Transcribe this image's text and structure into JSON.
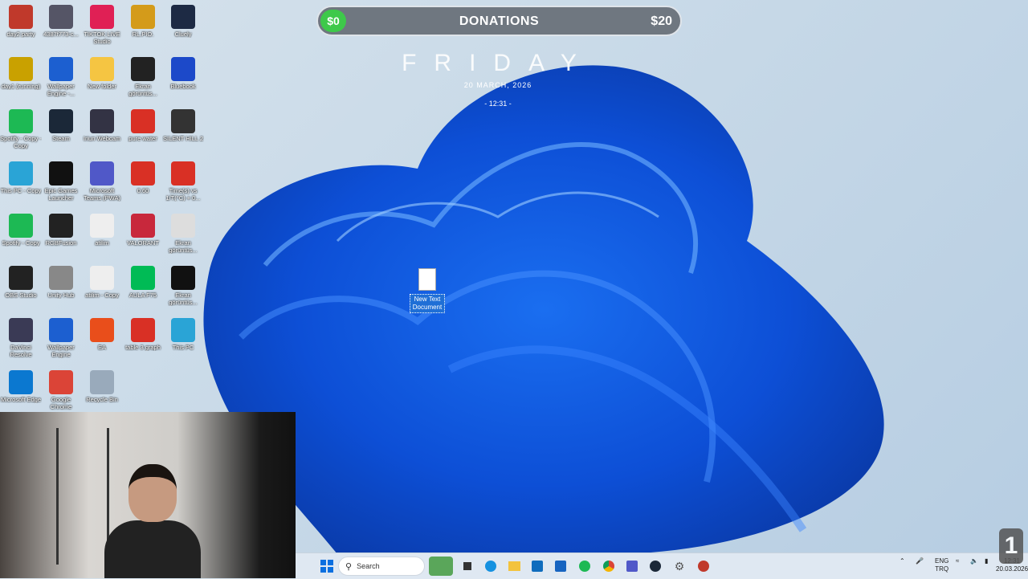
{
  "donation": {
    "current": "$0",
    "title": "DONATIONS",
    "goal": "$20",
    "progress_fraction": 0
  },
  "clock": {
    "day": "FRIDAY",
    "date": "20 MARCH, 2026",
    "time": "- 12:31 -"
  },
  "desktop_icons": [
    {
      "label": "day2 party",
      "color": "#c0392b"
    },
    {
      "label": "4387f773-c...",
      "color": "#556"
    },
    {
      "label": "TIKTOK LIVE Studio",
      "color": "#e02055"
    },
    {
      "label": "RL.PIO.",
      "color": "#d49b1a"
    },
    {
      "label": "Cluely",
      "color": "#1d2a44"
    },
    {
      "label": "day1 (running)",
      "color": "#c9a100"
    },
    {
      "label": "Wallpaper Engine -...",
      "color": "#1c5fd0"
    },
    {
      "label": "New folder",
      "color": "#f5c542"
    },
    {
      "label": "Ekran görüntüs...",
      "color": "#222"
    },
    {
      "label": "Bluebook",
      "color": "#1c49c9"
    },
    {
      "label": "Spotify - Copy - Copy",
      "color": "#1db954"
    },
    {
      "label": "Steam",
      "color": "#1b2838"
    },
    {
      "label": "Iriun Webcam",
      "color": "#334"
    },
    {
      "label": "pure water",
      "color": "#d93025"
    },
    {
      "label": "SILENT HILL 2",
      "color": "#333"
    },
    {
      "label": "This PC - Copy",
      "color": "#2aa4d6"
    },
    {
      "label": "Epic Games Launcher",
      "color": "#111"
    },
    {
      "label": "Microsoft Teams (PWA)",
      "color": "#5058c8"
    },
    {
      "label": "0.60",
      "color": "#d93025"
    },
    {
      "label": "Time(s) vs 1/T(°C) + 0...",
      "color": "#d93025"
    },
    {
      "label": "Spotify - Copy",
      "color": "#1db954"
    },
    {
      "label": "RGBFusion",
      "color": "#222"
    },
    {
      "label": "atilim",
      "color": "#eee"
    },
    {
      "label": "VALORANT",
      "color": "#c8283c"
    },
    {
      "label": "Ekran görüntüs...",
      "color": "#ddd"
    },
    {
      "label": "OBS Studio",
      "color": "#222"
    },
    {
      "label": "Unity Hub",
      "color": "#888"
    },
    {
      "label": "atilim - Copy",
      "color": "#eee"
    },
    {
      "label": "AULA F75",
      "color": "#0b5"
    },
    {
      "label": "Ekran görüntüs...",
      "color": "#111"
    },
    {
      "label": "DaVinci Resolve",
      "color": "#3a3a55"
    },
    {
      "label": "Wallpaper Engine",
      "color": "#1c5fd0"
    },
    {
      "label": "EA",
      "color": "#e94e1b"
    },
    {
      "label": "table 3 graph",
      "color": "#d93025"
    },
    {
      "label": "This PC",
      "color": "#2aa4d6"
    },
    {
      "label": "Microsoft Edge",
      "color": "#0b78d0"
    },
    {
      "label": "Google Chrome",
      "color": "#db4437"
    },
    {
      "label": "Recycle Bin",
      "color": "#9ab"
    }
  ],
  "selected_file": {
    "label": "New Text Document",
    "icon": "text-document-icon"
  },
  "taskbar": {
    "search_placeholder": "Search",
    "items": [
      "start",
      "search",
      "widgets",
      "task-view",
      "edge",
      "file-explorer",
      "outlook",
      "store",
      "spotify",
      "chrome",
      "teams",
      "steam",
      "settings",
      "game"
    ],
    "lang_top": "ENG",
    "lang_bottom": "TRQ",
    "tray_time": "12:31",
    "tray_date": "20.03.2026"
  },
  "notification_count": "1"
}
